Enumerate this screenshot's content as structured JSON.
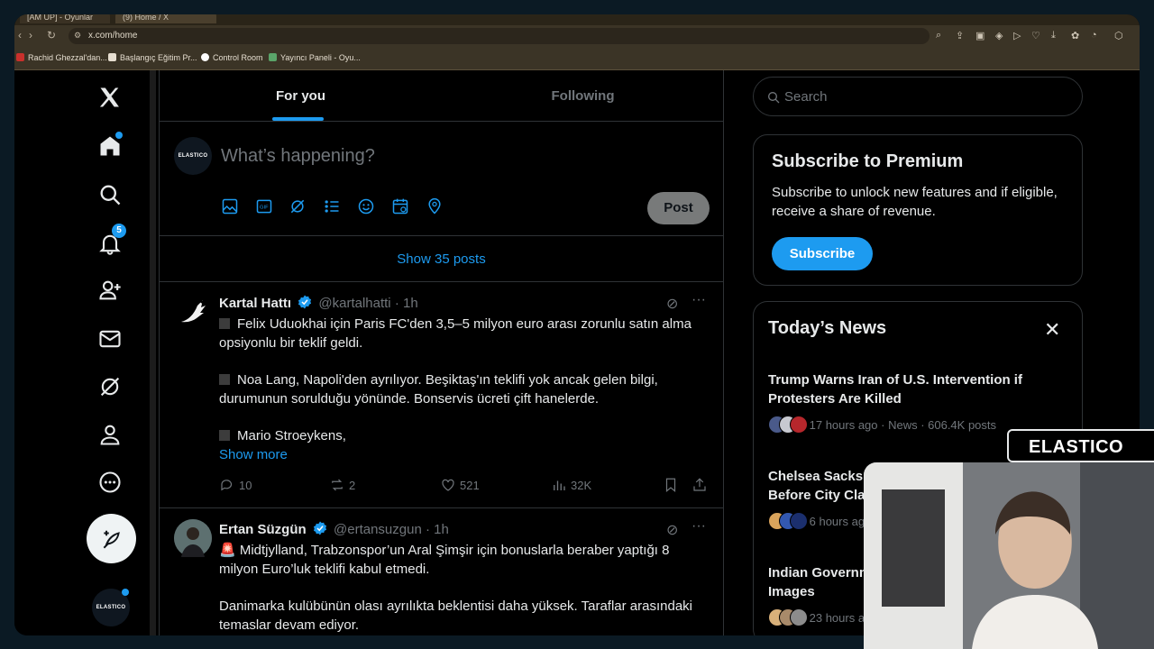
{
  "browser": {
    "tabs": [
      "[AM UP] - Oyunlar",
      "(9) Home / X"
    ],
    "url": "x.com/home",
    "bookmarks": [
      "Rachid Ghezzal'dan...",
      "Başlangıç Eğitim Pr...",
      "Control Room",
      "Yayıncı Paneli - Oyu..."
    ]
  },
  "sidebar": {
    "notifications_badge": "5",
    "account_avatar_text": "ELASTICO"
  },
  "timeline": {
    "tabs": [
      {
        "label": "For you"
      },
      {
        "label": "Following"
      }
    ],
    "composer": {
      "placeholder": "What’s happening?",
      "post_label": "Post",
      "avatar_text": "ELASTICO"
    },
    "show_posts": "Show 35 posts",
    "tweets": [
      {
        "name": "Kartal Hattı",
        "handle": "@kartalhatti",
        "time": "· 1h",
        "paragraphs": [
          "Felix Uduokhai için Paris FC'den 3,5–5 milyon euro arası zorunlu satın alma opsiyonlu bir teklif geldi.",
          "Noa Lang, Napoli'den ayrılıyor. Beşiktaş'ın teklifi yok ancak gelen bilgi, durumunun sorulduğu yönünde. Bonservis ücreti çift hanelerde.",
          "Mario Stroeykens,"
        ],
        "show_more": "Show more",
        "replies": "10",
        "reposts": "2",
        "likes": "521",
        "views": "32K"
      },
      {
        "name": "Ertan Süzgün",
        "handle": "@ertansuzgun",
        "time": "· 1h",
        "paragraphs": [
          "🚨 Midtjylland, Trabzonspor’un Aral Şimşir için bonuslarla beraber yaptığı 8 milyon Euro’luk teklifi kabul etmedi.",
          "Danimarka kulübünün olası ayrılıkta beklentisi daha yüksek. Taraflar arasındaki temaslar devam ediyor."
        ]
      }
    ]
  },
  "right": {
    "search_placeholder": "Search",
    "premium": {
      "title": "Subscribe to Premium",
      "text": "Subscribe to unlock new features and if eligible, receive a share of revenue.",
      "button": "Subscribe"
    },
    "news": {
      "title": "Today’s News",
      "items": [
        {
          "headline": "Trump Warns Iran of U.S. Intervention if Protesters Are Killed",
          "meta": "17 hours ago · News · 606.4K posts"
        },
        {
          "headline": "Chelsea Sacks Maresca After Poor Run Before City Clash",
          "meta": "6 hours ago"
        },
        {
          "headline": "Indian Government Flags Grok Over Explicit Images",
          "meta": "23 hours ago"
        }
      ]
    }
  },
  "overlay": {
    "brand": "ELASTICO"
  },
  "colors": {
    "accent": "#1d9bf0",
    "background": "#000000",
    "border": "#2f3336",
    "muted_text": "#71767b"
  }
}
